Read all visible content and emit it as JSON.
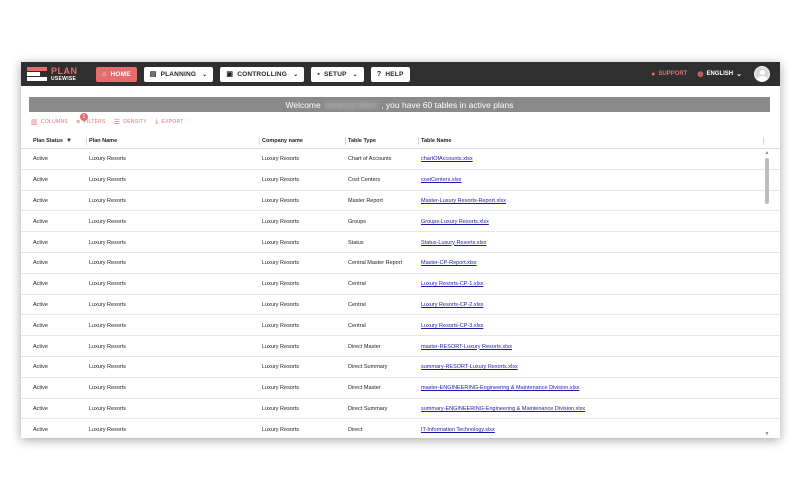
{
  "logo": {
    "line1": "PLAN",
    "line2": "USEWISE"
  },
  "nav": [
    {
      "label": "HOME",
      "icon": "home-icon",
      "glyph": "⌂",
      "chevron": ""
    },
    {
      "label": "PLANNING",
      "icon": "planning-icon",
      "glyph": "▤",
      "chevron": "⌄"
    },
    {
      "label": "CONTROLLING",
      "icon": "briefcase-icon",
      "glyph": "▣",
      "chevron": "⌄"
    },
    {
      "label": "SETUP",
      "icon": "setup-icon",
      "glyph": "▪",
      "chevron": "⌄"
    },
    {
      "label": "HELP",
      "icon": "help-icon",
      "glyph": "?",
      "chevron": ""
    }
  ],
  "header_tools": {
    "support": "SUPPORT",
    "language": "ENGLISH"
  },
  "banner": {
    "prefix": "Welcome",
    "name": "Amanya Mont",
    "suffix": ", you have 60 tables in active plans"
  },
  "toolbar": {
    "columns": "COLUMNS",
    "filters": "FILTERS",
    "filter_count": "1",
    "density": "DENSITY",
    "export": "EXPORT"
  },
  "table": {
    "columns": [
      "Plan Status",
      "Plan Name",
      "Company name",
      "Table Type",
      "Table Name"
    ],
    "rows": [
      [
        "Active",
        "Luxury Resorts",
        "Luxury Resorts",
        "Chart of Accounts",
        "chartOfAccounts.xlsx"
      ],
      [
        "Active",
        "Luxury Resorts",
        "Luxury Resorts",
        "Cost Centers",
        "costCenters.xlsx"
      ],
      [
        "Active",
        "Luxury Resorts",
        "Luxury Resorts",
        "Master Report",
        "Master-Luxury Resorts-Report.xlsx"
      ],
      [
        "Active",
        "Luxury Resorts",
        "Luxury Resorts",
        "Groups",
        "Groups-Luxury Resorts.xlsx"
      ],
      [
        "Active",
        "Luxury Resorts",
        "Luxury Resorts",
        "Status",
        "Status-Luxury Resorts.xlsx"
      ],
      [
        "Active",
        "Luxury Resorts",
        "Luxury Resorts",
        "Central Master Report",
        "Master-CP-Report.xlsx"
      ],
      [
        "Active",
        "Luxury Resorts",
        "Luxury Resorts",
        "Central",
        "Luxury Resorts-CP-1.xlsx"
      ],
      [
        "Active",
        "Luxury Resorts",
        "Luxury Resorts",
        "Central",
        "Luxury Resorts-CP-2.xlsx"
      ],
      [
        "Active",
        "Luxury Resorts",
        "Luxury Resorts",
        "Central",
        "Luxury Resorts-CP-3.xlsx"
      ],
      [
        "Active",
        "Luxury Resorts",
        "Luxury Resorts",
        "Direct Master",
        "master-RESORT-Luxury Resorts.xlsx"
      ],
      [
        "Active",
        "Luxury Resorts",
        "Luxury Resorts",
        "Direct Summary",
        "summary-RESORT-Luxury Resorts.xlsx"
      ],
      [
        "Active",
        "Luxury Resorts",
        "Luxury Resorts",
        "Direct Master",
        "master-ENGINEERING-Engineering & Maintenance Division.xlsx"
      ],
      [
        "Active",
        "Luxury Resorts",
        "Luxury Resorts",
        "Direct Summary",
        "summary-ENGINEERING-Engineering & Maintenance Division.xlsx"
      ],
      [
        "Active",
        "Luxury Resorts",
        "Luxury Resorts",
        "Direct",
        "IT-Information Technology.xlsx"
      ]
    ]
  },
  "colors": {
    "accent": "#e56d6d",
    "topbar": "#2f2f2f",
    "banner": "#8a8a8a",
    "link": "#1a1aa6"
  }
}
